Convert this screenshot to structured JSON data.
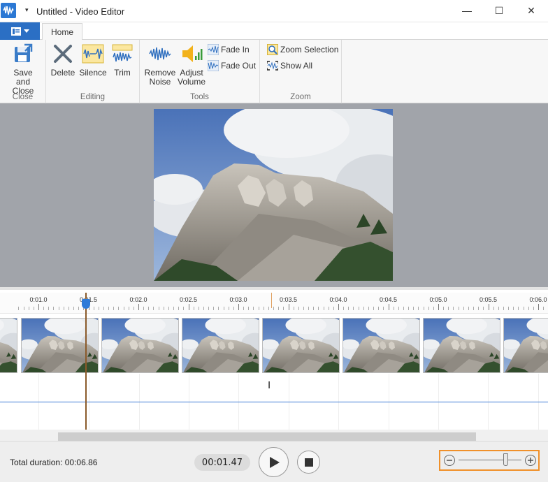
{
  "window": {
    "title": "Untitled - Video Editor",
    "quick_access": "▾",
    "minimize": "—",
    "maximize": "☐",
    "close": "✕"
  },
  "tabs": {
    "home_label": "Home"
  },
  "ribbon": {
    "groups": {
      "close": "Close",
      "editing": "Editing",
      "tools": "Tools",
      "zoom": "Zoom"
    },
    "save_close_line1": "Save and",
    "save_close_line2": "Close",
    "delete": "Delete",
    "silence": "Silence",
    "trim": "Trim",
    "remove_noise_line1": "Remove",
    "remove_noise_line2": "Noise",
    "adjust_volume_line1": "Adjust",
    "adjust_volume_line2": "Volume",
    "fade_in": "Fade In",
    "fade_out": "Fade Out",
    "zoom_selection": "Zoom Selection",
    "show_all": "Show All"
  },
  "timeline": {
    "ticks": [
      "0:01.0",
      "0:01.5",
      "0:02.0",
      "0:02.5",
      "0:03.0",
      "0:03.5",
      "0:04.0",
      "0:04.5",
      "0:05.0",
      "0:05.5",
      "0:06.0"
    ]
  },
  "bottom": {
    "total_duration": "Total duration: 00:06.86",
    "current_time": "00:01.47",
    "zoom_level": 0.75
  },
  "colors": {
    "accent": "#2b6fc4",
    "zoom_highlight": "#f0902a",
    "playhead": "#8a5a2a",
    "audio_line": "#3a7bd5"
  }
}
